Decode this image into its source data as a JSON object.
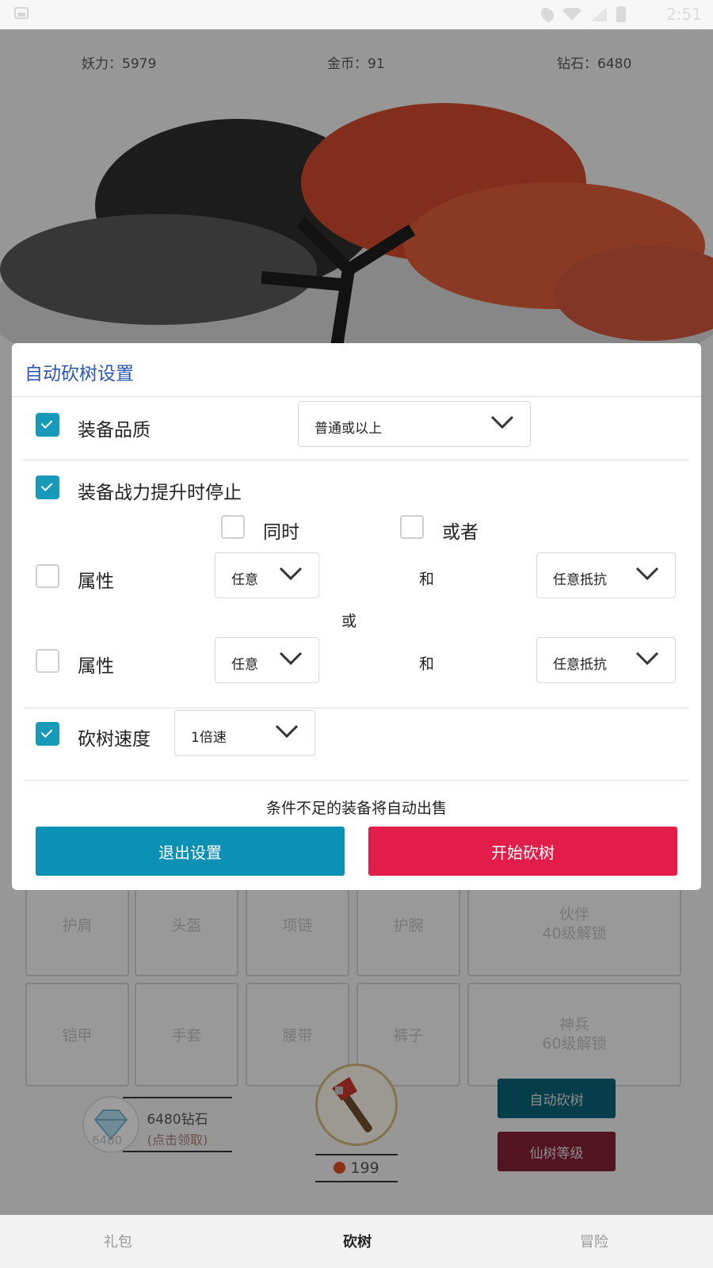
{
  "status_bar": {
    "time": "2:51"
  },
  "resources": {
    "yaoli": "妖力：5979",
    "gold": "金币：91",
    "diamond": "钻石：6480"
  },
  "equipment_slots": [
    {
      "label": "护肩"
    },
    {
      "label": "头盔"
    },
    {
      "label": "项链"
    },
    {
      "label": "护腕"
    },
    {
      "label": "伙伴",
      "sub": "40级解锁"
    },
    {
      "label": "铠甲"
    },
    {
      "label": "手套"
    },
    {
      "label": "腰带"
    },
    {
      "label": "裤子"
    },
    {
      "label": "神兵",
      "sub": "60级解锁"
    }
  ],
  "diamond_reward": {
    "icon_number": "6480",
    "title": "6480钻石",
    "claim": "(点击领取)"
  },
  "axe": {
    "apple_count": "199"
  },
  "game_buttons": {
    "auto_chop": "自动砍树",
    "tree_level": "仙树等级"
  },
  "bottom_nav": {
    "tabs": [
      "礼包",
      "砍树",
      "冒险"
    ],
    "active": "砍树"
  },
  "dialog": {
    "title": "自动砍树设置",
    "quality": {
      "checked": true,
      "label": "装备品质",
      "value": "普通或以上"
    },
    "power_stop": {
      "checked": true,
      "label": "装备战力提升时停止"
    },
    "mode": {
      "simultaneous": "同时",
      "either": "或者"
    },
    "attr1": {
      "checked": false,
      "label": "属性",
      "value": "任意",
      "and": "和",
      "resist": "任意抵抗"
    },
    "or_text": "或",
    "attr2": {
      "checked": false,
      "label": "属性",
      "value": "任意",
      "and": "和",
      "resist": "任意抵抗"
    },
    "speed": {
      "checked": true,
      "label": "砍树速度",
      "value": "1倍速"
    },
    "note": "条件不足的装备将自动出售",
    "exit_button": "退出设置",
    "start_button": "开始砍树"
  },
  "colors": {
    "accent_blue": "#0c91b6",
    "start_red": "#e21d4a",
    "title_blue": "#2e56b5",
    "checkbox": "#1799ba"
  }
}
